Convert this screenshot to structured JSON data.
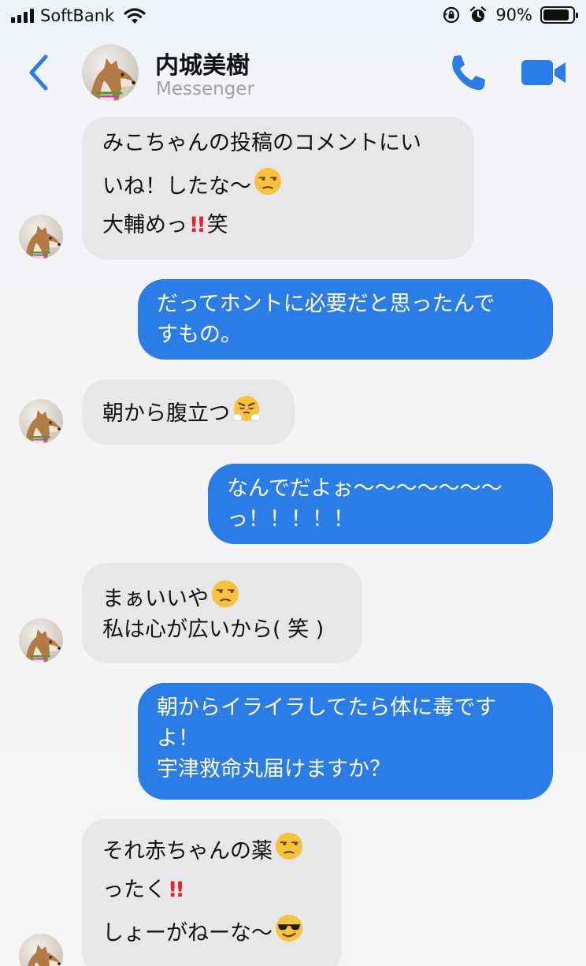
{
  "status_bar": {
    "carrier": "SoftBank",
    "battery_percent": "90%",
    "battery_level": 0.9
  },
  "header": {
    "contact_name": "内城美樹",
    "subtitle": "Messenger",
    "icons": [
      "back-chevron-icon",
      "phone-icon",
      "video-camera-icon"
    ]
  },
  "colors": {
    "accent": "#2a7de6",
    "incoming_bubble": "#e7e7e9",
    "outgoing_text": "#ffffff"
  },
  "messages": [
    {
      "sender": "contact",
      "lines": [
        {
          "text": "みこちゃんの投稿のコメントにい",
          "emoji": ""
        },
        {
          "text": "いね！したな〜",
          "emoji": "unamused-face"
        },
        {
          "text": "大輔めっ",
          "emoji": "double-exclamation",
          "after": "笑"
        }
      ]
    },
    {
      "sender": "me",
      "lines": [
        {
          "text": "だってホントに必要だと思ったんで"
        },
        {
          "text": "すもの。"
        }
      ]
    },
    {
      "sender": "contact",
      "lines": [
        {
          "text": "朝から腹立つ",
          "emoji": "face-with-steam"
        }
      ]
    },
    {
      "sender": "me",
      "lines": [
        {
          "text": "なんでだよぉ〜〜〜〜〜〜〜"
        },
        {
          "text": "っ！！！！！"
        }
      ]
    },
    {
      "sender": "contact",
      "lines": [
        {
          "text": "まぁいいや",
          "emoji": "unamused-face"
        },
        {
          "text": "私は心が広いから( 笑 )"
        }
      ]
    },
    {
      "sender": "me",
      "lines": [
        {
          "text": "朝からイライラしてたら体に毒です"
        },
        {
          "text": "よ！"
        },
        {
          "text": "宇津救命丸届けますか？"
        }
      ]
    },
    {
      "sender": "contact",
      "lines": [
        {
          "text": "それ赤ちゃんの薬",
          "emoji": "unamused-face"
        },
        {
          "text": "ったく",
          "emoji": "double-exclamation"
        },
        {
          "text": "しょーがねーな〜",
          "emoji": "smiling-face-with-sunglasses"
        }
      ]
    }
  ]
}
